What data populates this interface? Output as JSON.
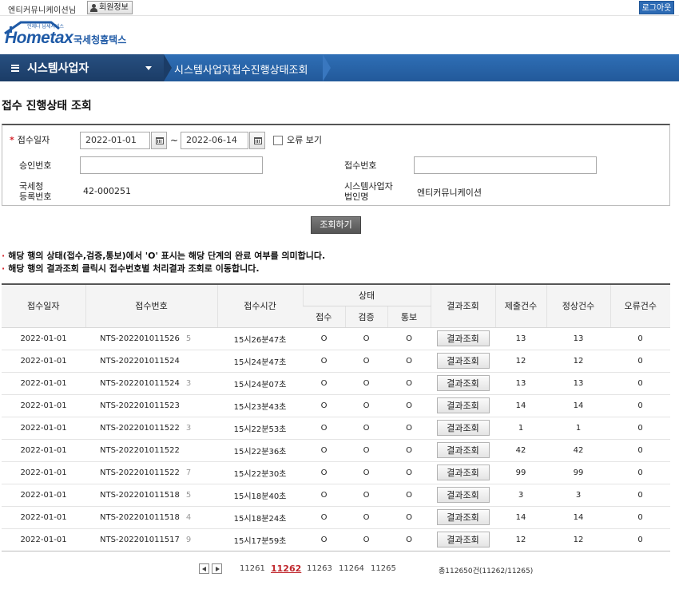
{
  "topbar": {
    "user": "엔티커뮤니케이션님",
    "member_info": "회원정보",
    "logout": "로그아웃"
  },
  "logo": {
    "brand": "Hometax",
    "tagline": "언제나 납세서비스",
    "korean": "국세청홈택스"
  },
  "nav": {
    "menu": "시스템사업자",
    "breadcrumb": "시스템사업자접수진행상태조회"
  },
  "page_title": "접수 진행상태 조회",
  "search": {
    "date_label": "접수일자",
    "date_from": "2022-01-01",
    "date_to": "2022-06-14",
    "date_sep": "~",
    "error_view_label": "오류 보기",
    "approval_label": "승인번호",
    "approval_value": "",
    "receipt_label": "접수번호",
    "receipt_value": "",
    "nts_reg_label_1": "국세청",
    "nts_reg_label_2": "등록번호",
    "nts_reg_value": "42-000251",
    "corp_label_1": "시스템사업자",
    "corp_label_2": "법인명",
    "corp_value": "엔티커뮤니케이션",
    "search_button": "조회하기"
  },
  "notices": [
    "해당 행의 상태(접수,검증,통보)에서 'O' 표시는 해당 단계의 완료 여부를 의미합니다.",
    "해당 행의 결과조회 클릭시 접수번호별 처리결과 조회로 이동합니다."
  ],
  "table": {
    "headers": {
      "date": "접수일자",
      "no": "접수번호",
      "time": "접수시간",
      "status": "상태",
      "s1": "접수",
      "s2": "검증",
      "s3": "통보",
      "result": "결과조회",
      "submit": "제출건수",
      "normal": "정상건수",
      "error": "오류건수"
    },
    "result_button": "결과조회",
    "rows": [
      {
        "date": "2022-01-01",
        "no": "NTS-202201011526",
        "suffix": "5",
        "time": "15시26분47초",
        "s1": "O",
        "s2": "O",
        "s3": "O",
        "submit": "13",
        "normal": "13",
        "error": "0"
      },
      {
        "date": "2022-01-01",
        "no": "NTS-202201011524",
        "suffix": "",
        "time": "15시24분47초",
        "s1": "O",
        "s2": "O",
        "s3": "O",
        "submit": "12",
        "normal": "12",
        "error": "0"
      },
      {
        "date": "2022-01-01",
        "no": "NTS-202201011524",
        "suffix": "3",
        "time": "15시24분07초",
        "s1": "O",
        "s2": "O",
        "s3": "O",
        "submit": "13",
        "normal": "13",
        "error": "0"
      },
      {
        "date": "2022-01-01",
        "no": "NTS-202201011523",
        "suffix": "",
        "time": "15시23분43초",
        "s1": "O",
        "s2": "O",
        "s3": "O",
        "submit": "14",
        "normal": "14",
        "error": "0"
      },
      {
        "date": "2022-01-01",
        "no": "NTS-202201011522",
        "suffix": "3",
        "time": "15시22분53초",
        "s1": "O",
        "s2": "O",
        "s3": "O",
        "submit": "1",
        "normal": "1",
        "error": "0"
      },
      {
        "date": "2022-01-01",
        "no": "NTS-202201011522",
        "suffix": "",
        "time": "15시22분36초",
        "s1": "O",
        "s2": "O",
        "s3": "O",
        "submit": "42",
        "normal": "42",
        "error": "0"
      },
      {
        "date": "2022-01-01",
        "no": "NTS-202201011522",
        "suffix": "7",
        "time": "15시22분30초",
        "s1": "O",
        "s2": "O",
        "s3": "O",
        "submit": "99",
        "normal": "99",
        "error": "0"
      },
      {
        "date": "2022-01-01",
        "no": "NTS-202201011518",
        "suffix": "5",
        "time": "15시18분40초",
        "s1": "O",
        "s2": "O",
        "s3": "O",
        "submit": "3",
        "normal": "3",
        "error": "0"
      },
      {
        "date": "2022-01-01",
        "no": "NTS-202201011518",
        "suffix": "4",
        "time": "15시18분24초",
        "s1": "O",
        "s2": "O",
        "s3": "O",
        "submit": "14",
        "normal": "14",
        "error": "0"
      },
      {
        "date": "2022-01-01",
        "no": "NTS-202201011517",
        "suffix": "9",
        "time": "15시17분59초",
        "s1": "O",
        "s2": "O",
        "s3": "O",
        "submit": "12",
        "normal": "12",
        "error": "0"
      }
    ]
  },
  "pager": {
    "pages": [
      "11261",
      "11262",
      "11263",
      "11264",
      "11265"
    ],
    "current": "11262",
    "total": "총112650건(11262/11265)"
  },
  "colors": {
    "brand_blue": "#2d6bb5",
    "nav_dark": "#1b3c66",
    "required_red": "#d5252c",
    "current_page_red": "#c0272d"
  }
}
